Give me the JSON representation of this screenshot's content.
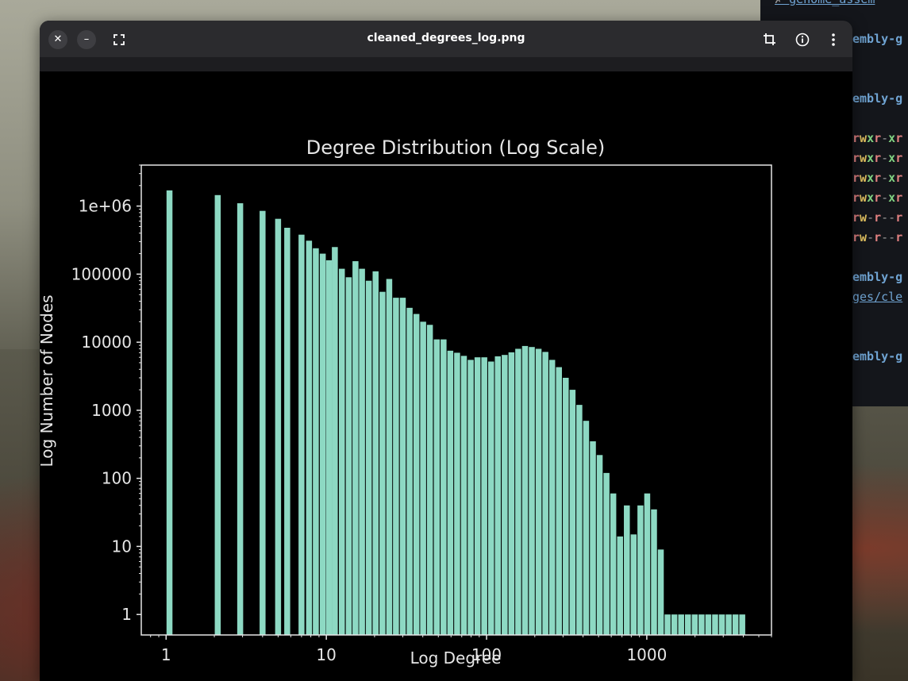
{
  "window": {
    "title": "cleaned_degrees_log.png",
    "close_icon": "close-icon",
    "minimize_icon": "minimize-icon",
    "fullscreen_icon": "fullscreen-icon",
    "crop_icon": "crop-icon",
    "info_icon": "info-icon",
    "menu_icon": "kebab-menu-icon"
  },
  "terminal": {
    "top_line": "genome_assem",
    "prompt_lines": [
      "embly-g",
      "embly-g",
      "embly-g",
      "embly-g"
    ],
    "perm_lines": [
      "rwxr-xr",
      "rwxr-xr",
      "rwxr-xr",
      "rwxr-xr",
      "rw-r--r",
      "rw-r--r"
    ],
    "link_line": "ges/cle"
  },
  "chart_data": {
    "type": "bar",
    "title": "Degree Distribution (Log Scale)",
    "xlabel": "Log Degree",
    "ylabel": "Log Number of Nodes",
    "x_scale": "log",
    "y_scale": "log",
    "xlim": [
      0.7,
      6000
    ],
    "ylim": [
      0.5,
      4000000
    ],
    "x_ticks": [
      1,
      10,
      100,
      1000
    ],
    "x_tick_labels": [
      "1",
      "10",
      "100",
      "1000"
    ],
    "y_ticks": [
      1,
      10,
      100,
      1000,
      10000,
      100000,
      1000000
    ],
    "y_tick_labels": [
      "1",
      "10",
      "100",
      "1000",
      "10000",
      "100000",
      "1e+06"
    ],
    "bar_color": "#8dd9c3",
    "background": "#000000",
    "grid": false,
    "x": [
      1.05,
      2.1,
      2.9,
      4.0,
      5.0,
      5.7,
      7.0,
      7.8,
      8.6,
      9.5,
      10.4,
      11.3,
      12.5,
      13.8,
      15.2,
      16.7,
      18.4,
      20.3,
      22.4,
      24.7,
      27.2,
      30.0,
      33.1,
      36.5,
      40.2,
      44.3,
      48.9,
      53.9,
      59.4,
      65.5,
      72.2,
      79.6,
      87.8,
      96.8,
      106.7,
      117.6,
      129.7,
      143.0,
      157.6,
      173.8,
      191.6,
      211.2,
      232.9,
      256.7,
      283.0,
      312.0,
      344.0,
      379.3,
      418.1,
      461.0,
      508.2,
      560.3,
      617.7,
      681.0,
      750.8,
      827.7,
      912.5,
      1006.1,
      1109.2,
      1222.8,
      1348.1,
      1486.3,
      1638.6,
      1806.5,
      1991.6,
      2195.7,
      2420.7,
      2668.7,
      2942.2,
      3243.7,
      3576.1,
      3942.5
    ],
    "values": [
      1700000,
      1450000,
      1100000,
      850000,
      650000,
      480000,
      380000,
      310000,
      240000,
      200000,
      160000,
      250000,
      120000,
      90000,
      155000,
      120000,
      80000,
      110000,
      55000,
      85000,
      45000,
      45000,
      32000,
      26000,
      20000,
      18000,
      11000,
      11000,
      7500,
      7000,
      6300,
      5500,
      6000,
      6000,
      5200,
      6200,
      6500,
      7100,
      8000,
      8800,
      8500,
      8000,
      7200,
      5500,
      4300,
      3000,
      2000,
      1200,
      700,
      350,
      220,
      120,
      60,
      14,
      40,
      15,
      40,
      60,
      35,
      9,
      1,
      1,
      1,
      1,
      1,
      1,
      1,
      1,
      1,
      1,
      1,
      1
    ]
  }
}
